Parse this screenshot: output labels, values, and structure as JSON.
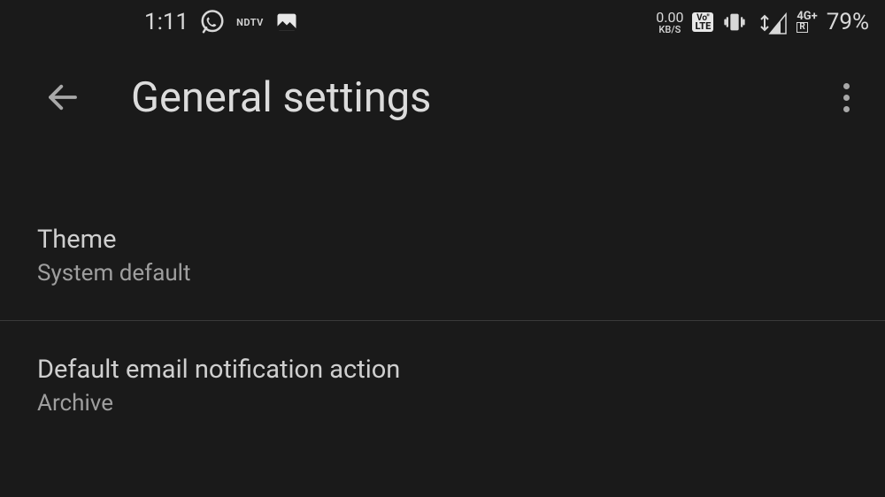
{
  "status_bar": {
    "time": "1:11",
    "data_rate_value": "0.00",
    "data_rate_unit": "KB/S",
    "volte_top": "Vo\"",
    "volte_bottom": "LTE",
    "network_type": "4G+",
    "network_roaming": "R",
    "battery_pct": "79%"
  },
  "app_bar": {
    "title": "General settings"
  },
  "settings": [
    {
      "title": "Theme",
      "value": "System default"
    },
    {
      "title": "Default email notification action",
      "value": "Archive"
    }
  ]
}
